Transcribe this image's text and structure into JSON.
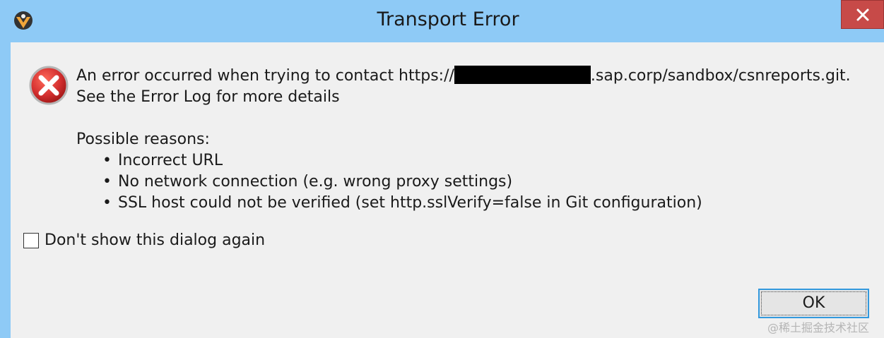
{
  "window": {
    "title": "Transport Error",
    "app_icon": "eclipse-icon",
    "close_icon": "close-icon"
  },
  "message": {
    "line1_prefix": "An error occurred when trying to contact https://",
    "line1_suffix": ".sap.corp/sandbox/csnreports.git.",
    "line2": "See the Error Log for more details",
    "reasons_heading": "Possible reasons:",
    "reasons": [
      "Incorrect URL",
      "No network connection (e.g. wrong proxy settings)",
      "SSL host could not be verified (set http.sslVerify=false in Git configuration)"
    ],
    "bullet": "•"
  },
  "checkbox": {
    "label": "Don't show this dialog again",
    "checked": false
  },
  "buttons": {
    "ok_label": "OK"
  },
  "watermark": "@稀土掘金技术社区",
  "colors": {
    "titlebar": "#8ecaf6",
    "close_button": "#c74a48",
    "client_bg": "#f0f0f0",
    "error_icon": "#d32f2f"
  }
}
